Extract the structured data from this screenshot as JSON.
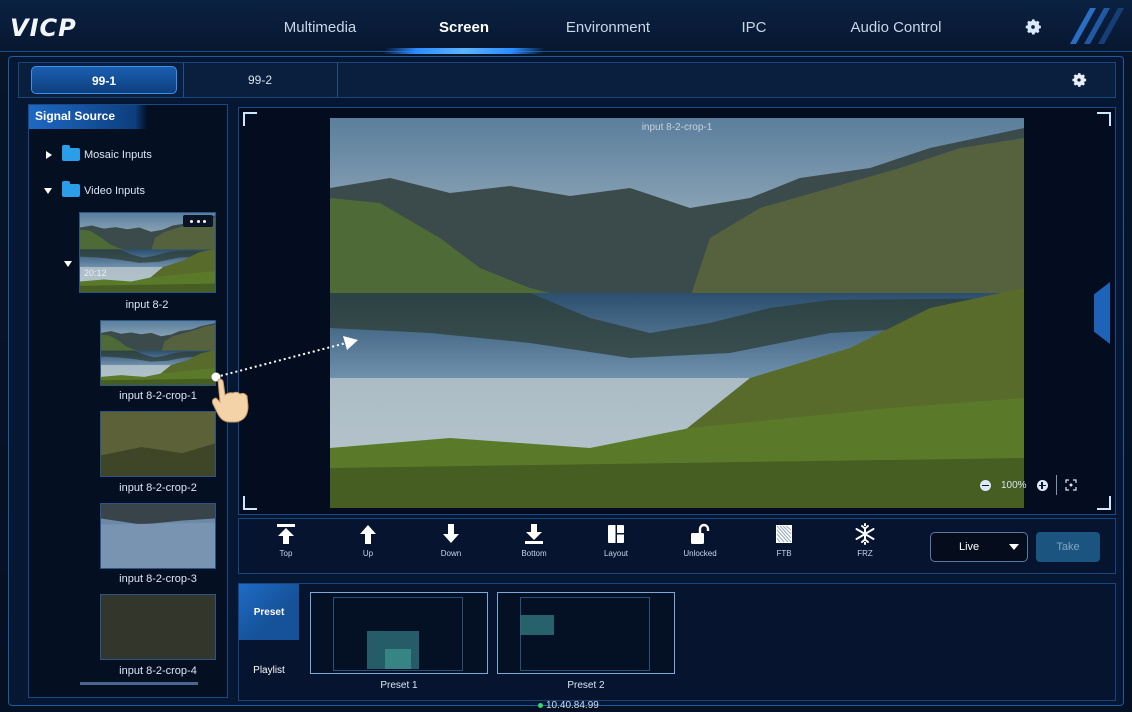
{
  "app": {
    "logo": "VICP"
  },
  "nav": {
    "tabs": [
      {
        "label": "Multimedia"
      },
      {
        "label": "Screen"
      },
      {
        "label": "Environment"
      },
      {
        "label": "IPC"
      },
      {
        "label": "Audio Control"
      }
    ],
    "active": "Screen"
  },
  "screens": {
    "tabs": [
      {
        "label": "99-1"
      },
      {
        "label": "99-2"
      }
    ],
    "active": "99-1"
  },
  "signal_source": {
    "title": "Signal Source",
    "folders": [
      {
        "label": "Mosaic Inputs",
        "expanded": false
      },
      {
        "label": "Video Inputs",
        "expanded": true
      }
    ],
    "inputs": [
      {
        "label": "input 8-2",
        "time": "20:12",
        "more_icon": "more-dots-icon"
      },
      {
        "label": "input 8-2-crop-1"
      },
      {
        "label": "input 8-2-crop-2"
      },
      {
        "label": "input 8-2-crop-3"
      },
      {
        "label": "input 8-2-crop-4"
      }
    ]
  },
  "preview": {
    "layer_label": "input 8-2-crop-1",
    "zoom": "100%"
  },
  "toolbar": {
    "buttons": [
      {
        "label": "Top",
        "icon": "arrow-to-top-icon"
      },
      {
        "label": "Up",
        "icon": "arrow-up-icon"
      },
      {
        "label": "Down",
        "icon": "arrow-down-icon"
      },
      {
        "label": "Bottom",
        "icon": "arrow-to-bottom-icon"
      },
      {
        "label": "Layout",
        "icon": "layout-icon"
      },
      {
        "label": "Unlocked",
        "icon": "unlock-icon"
      },
      {
        "label": "FTB",
        "icon": "ftb-icon"
      },
      {
        "label": "FRZ",
        "icon": "snowflake-icon"
      }
    ],
    "mode_select": "Live",
    "take_label": "Take"
  },
  "bottom": {
    "tabs": [
      {
        "label": "Preset"
      },
      {
        "label": "Playlist"
      }
    ],
    "active": "Preset",
    "presets": [
      {
        "label": "Preset 1"
      },
      {
        "label": "Preset 2"
      }
    ]
  },
  "status": {
    "ip": "10.40.84.99"
  },
  "colors": {
    "accent": "#2b8cff",
    "panel": "#061430",
    "border": "#1a4a85",
    "online": "#3ad56b"
  }
}
